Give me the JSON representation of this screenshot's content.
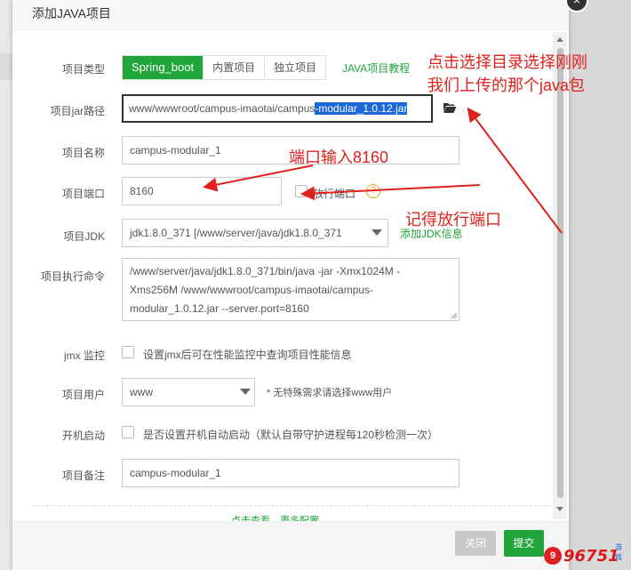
{
  "dialog": {
    "title": "添加JAVA项目",
    "close_glyph": "×"
  },
  "form": {
    "project_type": {
      "label": "项目类型",
      "options": [
        "Spring_boot",
        "内置项目",
        "独立项目"
      ],
      "selected": "Spring_boot",
      "tutorial_link": "JAVA项目教程"
    },
    "jar_path": {
      "label": "项目jar路径",
      "value_plain": "www/wwwroot/campus-imaotai/campus",
      "value_selected": "-modular_1.0.12.jar",
      "browse_icon": "folder-open-icon"
    },
    "project_name": {
      "label": "项目名称",
      "value": "campus-modular_1"
    },
    "project_port": {
      "label": "项目端口",
      "value": "8160",
      "allow_port_label": "放行端口",
      "help_glyph": "?"
    },
    "jdk": {
      "label": "项目JDK",
      "value": "jdk1.8.0_371 [/www/server/java/jdk1.8.0_371",
      "add_link": "添加JDK信息"
    },
    "exec_command": {
      "label": "项目执行命令",
      "lines": [
        "/www/server/java/jdk1.8.0_371/bin/java  -jar -Xmx1024M -",
        "Xms256M  /www/wwwroot/campus-imaotai/campus-",
        "modular_1.0.12.jar --server.port=8160"
      ]
    },
    "jmx": {
      "label": "jmx 监控",
      "text": "设置jmx后可在性能监控中查询项目性能信息"
    },
    "project_user": {
      "label": "项目用户",
      "value": "www",
      "hint": "* 无特殊需求请选择www用户"
    },
    "autostart": {
      "label": "开机启动",
      "text": "是否设置开机自动启动（默认自带守护进程每120秒检测一次）"
    },
    "remark": {
      "label": "项目备注",
      "value": "campus-modular_1"
    },
    "more_config": "点击查看，更多配置"
  },
  "footer": {
    "close_label": "关闭",
    "submit_label": "提交"
  },
  "annotations": {
    "choose_dir_line1": "点击选择目录选择刚刚",
    "choose_dir_line2": "我们上传的那个java包",
    "port_input": "端口输入8160",
    "open_port": "记得放行端口"
  },
  "watermark": {
    "logo": "9",
    "text": "96751",
    "small": "游戏"
  },
  "colors": {
    "accent": "#20a53a",
    "annotation": "#e0211d",
    "selection": "#1a68d8"
  }
}
